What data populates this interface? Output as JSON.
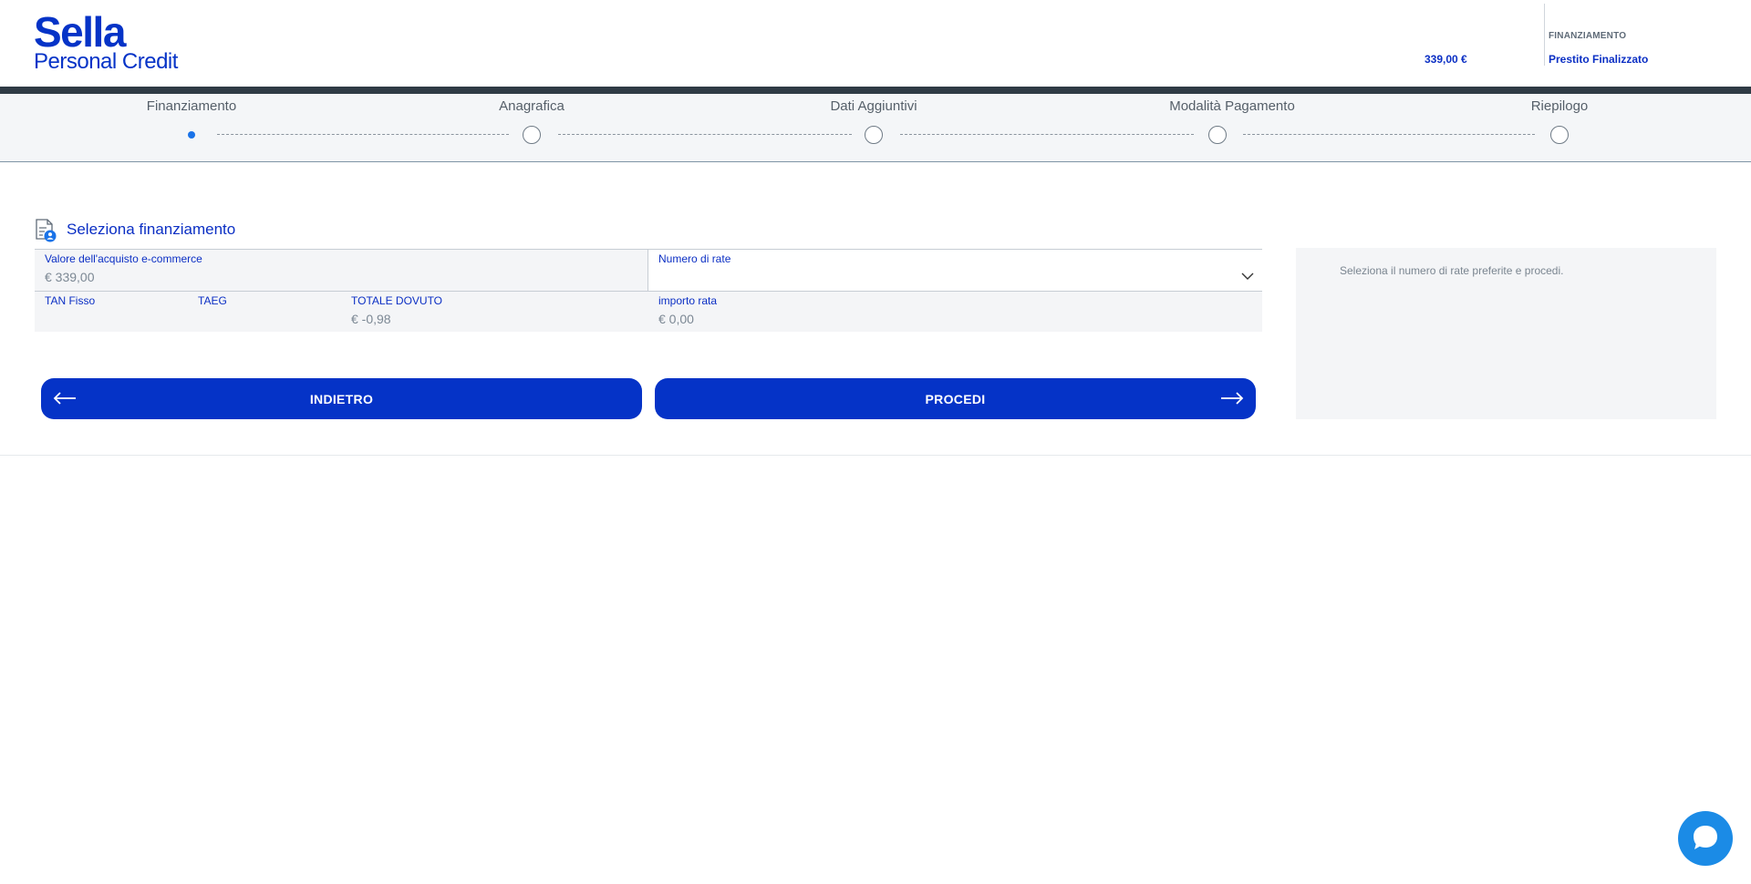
{
  "brand": {
    "name_main": "Sella",
    "name_sub": "Personal Credit"
  },
  "header": {
    "amount": "339,00 €",
    "financing_label": "FINANZIAMENTO",
    "financing_value": "Prestito Finalizzato"
  },
  "stepper": {
    "steps": [
      {
        "label": "Finanziamento",
        "active": true
      },
      {
        "label": "Anagrafica",
        "active": false
      },
      {
        "label": "Dati Aggiuntivi",
        "active": false
      },
      {
        "label": "Modalità Pagamento",
        "active": false
      },
      {
        "label": "Riepilogo",
        "active": false
      }
    ]
  },
  "section": {
    "title": "Seleziona finanziamento",
    "icon": "document-user-icon"
  },
  "form": {
    "purchase_label": "Valore dell'acquisto e-commerce",
    "purchase_value": "€ 339,00",
    "installments_label": "Numero di rate",
    "installments_value": "",
    "tan_label": "TAN Fisso",
    "tan_value": "",
    "taeg_label": "TAEG",
    "taeg_value": "",
    "total_label": "TOTALE DOVUTO",
    "total_value": "€ -0,98",
    "installment_amount_label": "importo rata",
    "installment_amount_value": "€ 0,00"
  },
  "buttons": {
    "back_label": "INDIETRO",
    "next_label": "PROCEDI"
  },
  "side_panel": {
    "message": "Seleziona il numero di rate preferite e procedi."
  },
  "colors": {
    "brand_blue": "#0533c7",
    "active_step": "#1a73e8",
    "chat_blue": "#1b8be6",
    "header_bar": "#2f3b45"
  }
}
